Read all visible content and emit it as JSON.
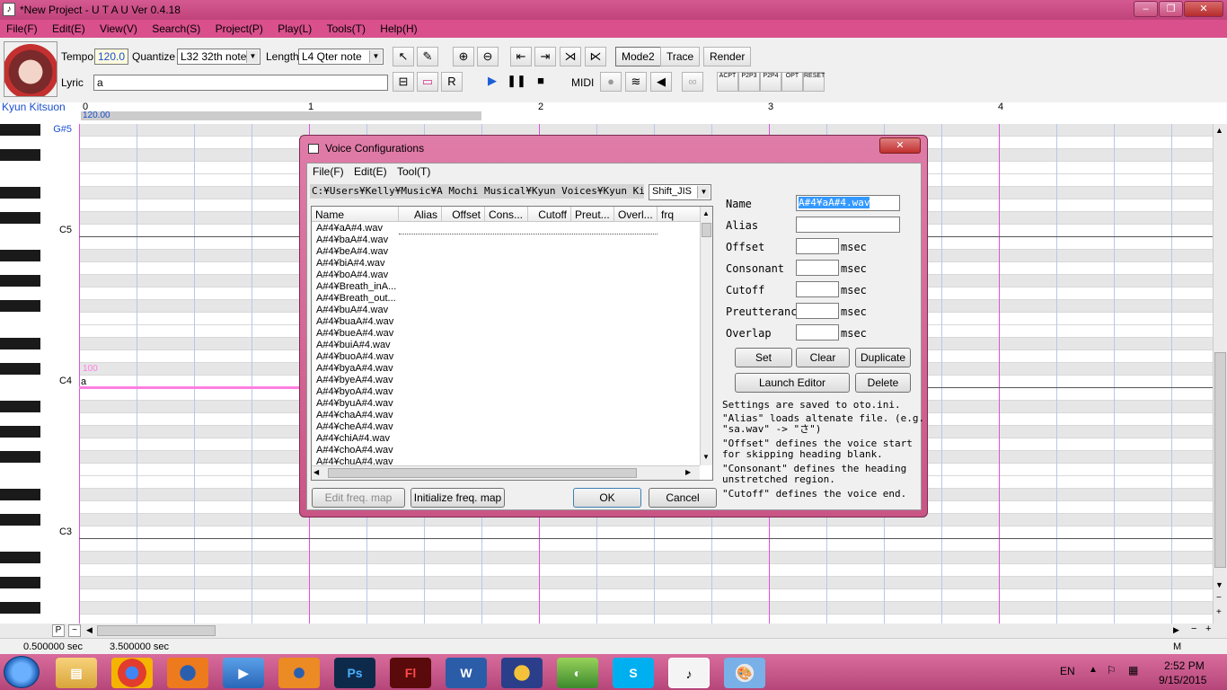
{
  "window": {
    "title": "*New Project - U T A U  Ver 0.4.18",
    "min": "‒",
    "max": "❐",
    "close": "✕"
  },
  "menu": [
    "File(F)",
    "Edit(E)",
    "View(V)",
    "Search(S)",
    "Project(P)",
    "Play(L)",
    "Tools(T)",
    "Help(H)"
  ],
  "toolbar": {
    "tempo_label": "Tempo",
    "tempo_value": "120.0",
    "quantize_label": "Quantize",
    "quantize_value": "L32 32th note",
    "length_label": "Length",
    "length_value": "L4   Qter note",
    "lyric_label": "Lyric",
    "lyric_value": "a",
    "mode2": "Mode2",
    "trace": "Trace",
    "render": "Render",
    "midi": "MIDI",
    "plugins": [
      "ACPT",
      "P2P3",
      "P2P4",
      "OPT",
      "RESET"
    ]
  },
  "piano_roll": {
    "voice_name": "Kyun Kitsuon",
    "bars": [
      "0",
      "1",
      "2",
      "3",
      "4"
    ],
    "tempo_marker": "120.00",
    "key_labels": [
      "G#5",
      "C5",
      "C4",
      "C3"
    ],
    "note_velocity": "100",
    "note_lyric": "a"
  },
  "status": {
    "left": "0.500000 sec",
    "right": "3.500000 sec",
    "mode": "M",
    "p_btn": "P",
    "tilde_btn": "~"
  },
  "dialog": {
    "title": "Voice Configurations",
    "close": "✕",
    "menu": [
      "File(F)",
      "Edit(E)",
      "Tool(T)"
    ],
    "path": "C:¥Users¥Kelly¥Music¥A Mochi Musical¥Kyun Voices¥Kyun Kitsuon",
    "encoding": "Shift_JIS",
    "columns": [
      "Name",
      "Alias",
      "Offset",
      "Cons...",
      "Cutoff",
      "Preut...",
      "Overl...",
      "frq"
    ],
    "files": [
      "A#4¥aA#4.wav",
      "A#4¥baA#4.wav",
      "A#4¥beA#4.wav",
      "A#4¥biA#4.wav",
      "A#4¥boA#4.wav",
      "A#4¥Breath_inA...",
      "A#4¥Breath_out...",
      "A#4¥buA#4.wav",
      "A#4¥buaA#4.wav",
      "A#4¥bueA#4.wav",
      "A#4¥buiA#4.wav",
      "A#4¥buoA#4.wav",
      "A#4¥byaA#4.wav",
      "A#4¥byeA#4.wav",
      "A#4¥byoA#4.wav",
      "A#4¥byuA#4.wav",
      "A#4¥chaA#4.wav",
      "A#4¥cheA#4.wav",
      "A#4¥chiA#4.wav",
      "A#4¥choA#4.wav",
      "A#4¥chuA#4.wav"
    ],
    "fields": {
      "name_label": "Name",
      "name_value": "A#4¥aA#4.wav",
      "alias_label": "Alias",
      "offset_label": "Offset",
      "consonant_label": "Consonant",
      "cutoff_label": "Cutoff",
      "preutterance_label": "Preutterance",
      "overlap_label": "Overlap",
      "unit": "msec"
    },
    "buttons": {
      "set": "Set",
      "clear": "Clear",
      "duplicate": "Duplicate",
      "launch_editor": "Launch Editor",
      "delete": "Delete",
      "edit_freq": "Edit freq. map",
      "init_freq": "Initialize freq. map",
      "ok": "OK",
      "cancel": "Cancel"
    },
    "help": [
      "Settings are saved to oto.ini.",
      "\"Alias\" loads altenate file. (e.g.\n\"sa.wav\" -> \"さ\")",
      "\"Offset\" defines the voice start\nfor skipping heading blank.",
      "\"Consonant\" defines the heading\nunstretched region.",
      "\"Cutoff\" defines the voice end."
    ]
  },
  "taskbar": {
    "lang": "EN",
    "time": "2:52 PM",
    "date": "9/15/2015",
    "apps": [
      "Windows Explorer",
      "Google Chrome",
      "Firefox",
      "Media Player",
      "Blender",
      "Photoshop",
      "Flash",
      "Word",
      "Audacity",
      "Audio App",
      "Skype",
      "UTAU",
      "Paint"
    ]
  },
  "colors": {
    "titlebar": "#c9508a",
    "accent_blue": "#1a4fcf",
    "note_pink": "#ff7fe0",
    "bar_line": "#e050e0"
  }
}
